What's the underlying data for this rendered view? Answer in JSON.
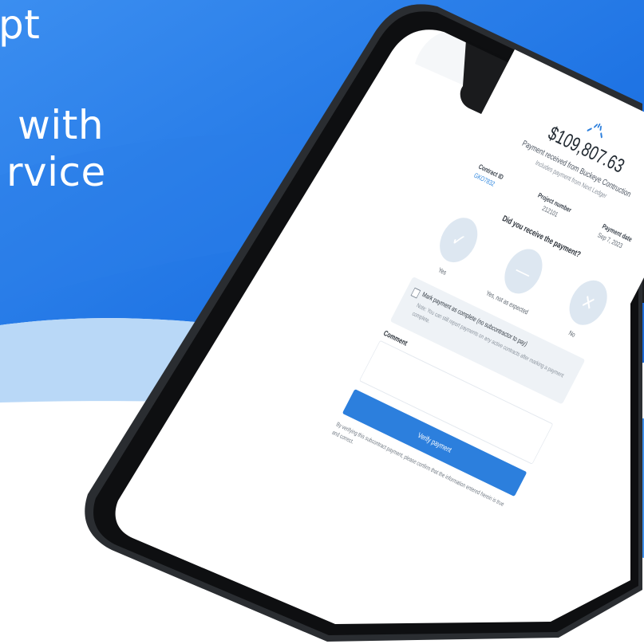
{
  "headline": {
    "line1": "pt",
    "line2": "with",
    "line3": "rvice"
  },
  "payment": {
    "amount": "$109,807.63",
    "received_from": "Payment received from Buckeye Contruction",
    "includes_note": "Includes payment from Next Ledger",
    "contract_id_label": "Contract ID",
    "contract_id_value": "GKO7832",
    "project_number_label": "Project number",
    "project_number_value": "212101",
    "payment_date_label": "Payment date",
    "payment_date_value": "Sep 7, 2023",
    "question": "Did you receive the payment?",
    "choices": [
      {
        "label": "Yes",
        "icon": "check-icon"
      },
      {
        "label": "Yes, not as expected",
        "icon": "minus-icon"
      },
      {
        "label": "No",
        "icon": "x-icon"
      }
    ],
    "checkbox_label": "Mark payment as complete (no subcontractor to pay)",
    "checkbox_note": "Note: You can still report payments on any active contracts after marking a payment complete.",
    "comment_label": "Comment",
    "verify_button": "Verify payment",
    "disclaimer": "By verifying this subcontract payment, please confirm that the information entered herein is true and correct."
  },
  "colors": {
    "primary_blue": "#2c7fdd",
    "light_blue": "#7ab6f3",
    "pale_blue": "#b9d8f7",
    "choice_circle": "#dde7f1"
  }
}
